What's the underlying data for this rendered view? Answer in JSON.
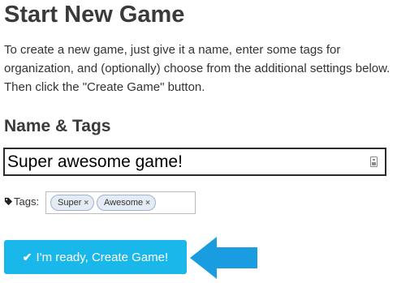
{
  "page": {
    "title": "Start New Game",
    "intro": "To create a new game, just give it a name, enter some tags for organization, and (optionally) choose from the additional settings below. Then click the \"Create Game\" button."
  },
  "name_tags": {
    "heading": "Name & Tags",
    "name_value": "Super awesome game!",
    "tags_label": "Tags:",
    "tags": [
      {
        "label": "Super",
        "remove_glyph": "×"
      },
      {
        "label": "Awesome",
        "remove_glyph": "×"
      }
    ]
  },
  "actions": {
    "create_label": "I'm ready, Create Game!",
    "check_glyph": "✔"
  },
  "icons": {
    "field": "address-card-icon",
    "tag": "tag-icon",
    "check": "check-icon",
    "pointer": "arrow-left-icon"
  },
  "colors": {
    "button": "#1ab7ea",
    "pointer_arrow": "#1a9de0",
    "tag_chip_bg": "#e4ebf4",
    "tag_chip_border": "#9fb4cc"
  }
}
